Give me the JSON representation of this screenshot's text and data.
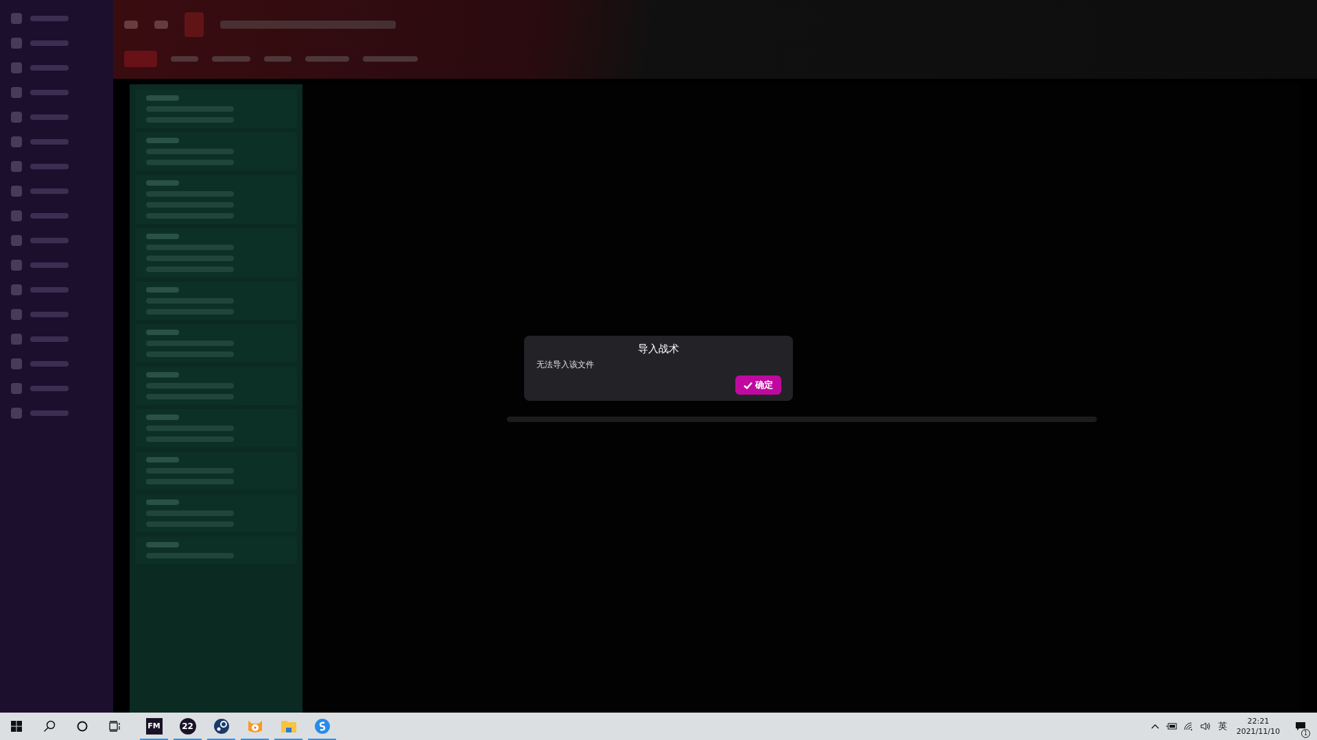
{
  "dialog": {
    "title": "导入战术",
    "message": "无法导入该文件",
    "button": "确定"
  },
  "taskbar": {
    "apps": [
      {
        "kind": "fm",
        "label": "FM",
        "running": true
      },
      {
        "kind": "badge",
        "label": "22",
        "running": true
      },
      {
        "kind": "steam",
        "running": true
      },
      {
        "kind": "mascot",
        "running": true
      },
      {
        "kind": "folder",
        "running": true
      },
      {
        "kind": "browser",
        "running": true
      }
    ],
    "tray": {
      "ime": "英",
      "time": "22:21",
      "date": "2021/11/10",
      "notifications": "1"
    }
  }
}
